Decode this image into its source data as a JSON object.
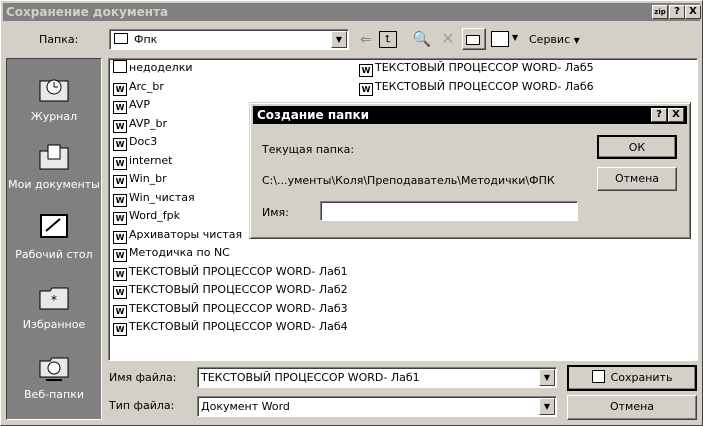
{
  "window": {
    "title": "Сохранение документа",
    "title_buttons": [
      "zip",
      "?",
      "X"
    ]
  },
  "toolbar": {
    "folder_label": "Папка:",
    "folder_value": "Фпк",
    "service_label": "Сервис"
  },
  "places": [
    {
      "label": "Журнал",
      "icon": "history-icon"
    },
    {
      "label": "Мои документы",
      "icon": "my-documents-icon"
    },
    {
      "label": "Рабочий стол",
      "icon": "desktop-icon"
    },
    {
      "label": "Избранное",
      "icon": "favorites-icon"
    },
    {
      "label": "Веб-папки",
      "icon": "web-folders-icon"
    }
  ],
  "files_col1": [
    {
      "name": "недоделки",
      "type": "folder"
    },
    {
      "name": "Arc_br",
      "type": "doc"
    },
    {
      "name": "AVP",
      "type": "doc"
    },
    {
      "name": "AVP_br",
      "type": "doc"
    },
    {
      "name": "Doc3",
      "type": "doc"
    },
    {
      "name": "internet",
      "type": "doc"
    },
    {
      "name": "Win_br",
      "type": "doc"
    },
    {
      "name": "Win_чистая",
      "type": "doc"
    },
    {
      "name": "Word_fpk",
      "type": "doc"
    },
    {
      "name": "Архиваторы чистая",
      "type": "doc"
    },
    {
      "name": "Методичка по NC",
      "type": "doc"
    },
    {
      "name": "ТЕКСТОВЫЙ ПРОЦЕССОР WORD- Лаб1",
      "type": "doc"
    },
    {
      "name": "ТЕКСТОВЫЙ ПРОЦЕССОР WORD- Лаб2",
      "type": "doc"
    },
    {
      "name": "ТЕКСТОВЫЙ ПРОЦЕССОР WORD- Лаб3",
      "type": "doc"
    },
    {
      "name": "ТЕКСТОВЫЙ ПРОЦЕССОР WORD- Лаб4",
      "type": "doc"
    }
  ],
  "files_col2": [
    {
      "name": "ТЕКСТОВЫЙ ПРОЦЕССОР WORD- Лаб5",
      "type": "doc"
    },
    {
      "name": "ТЕКСТОВЫЙ ПРОЦЕССОР WORD- Лаб6",
      "type": "doc"
    }
  ],
  "footer": {
    "filename_label": "Имя файла:",
    "filename_value": "ТЕКСТОВЫЙ ПРОЦЕССОР WORD- Лаб1",
    "filetype_label": "Тип файла:",
    "filetype_value": "Документ Word",
    "save_label": "Сохранить",
    "cancel_label": "Отмена"
  },
  "dialog": {
    "title": "Создание папки",
    "current_folder_label": "Текущая папка:",
    "current_folder_path": "C:\\...ументы\\Коля\\Преподаватель\\Методички\\ФПК",
    "name_label": "Имя:",
    "name_value": "",
    "ok_label": "ОК",
    "cancel_label": "Отмена"
  }
}
